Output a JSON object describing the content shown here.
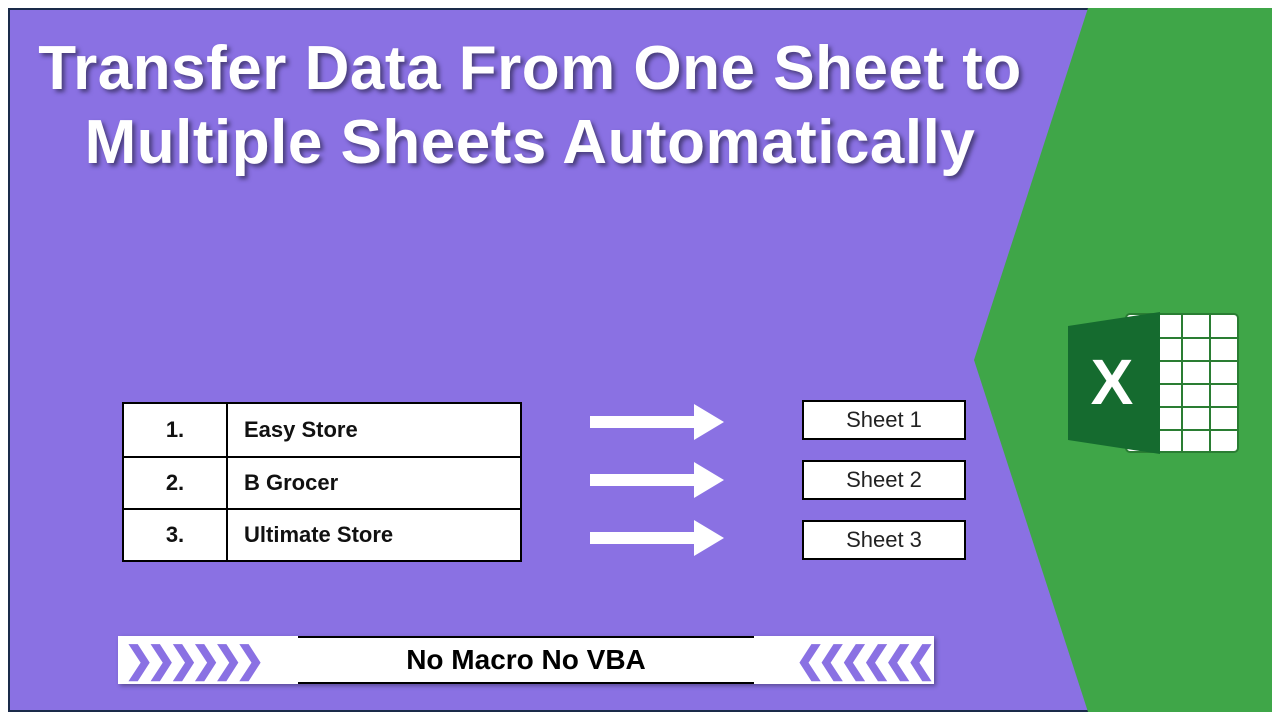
{
  "title": "Transfer Data From One Sheet to Multiple Sheets Automatically",
  "stores": [
    {
      "num": "1.",
      "name": "Easy Store"
    },
    {
      "num": "2.",
      "name": "B Grocer"
    },
    {
      "num": "3.",
      "name": "Ultimate Store"
    }
  ],
  "sheets": [
    "Sheet 1",
    "Sheet 2",
    "Sheet 3"
  ],
  "banner": "No Macro No VBA",
  "chev_left": "❯❯❯❯❯❯",
  "chev_right": "❮❮❮❮❮❮"
}
